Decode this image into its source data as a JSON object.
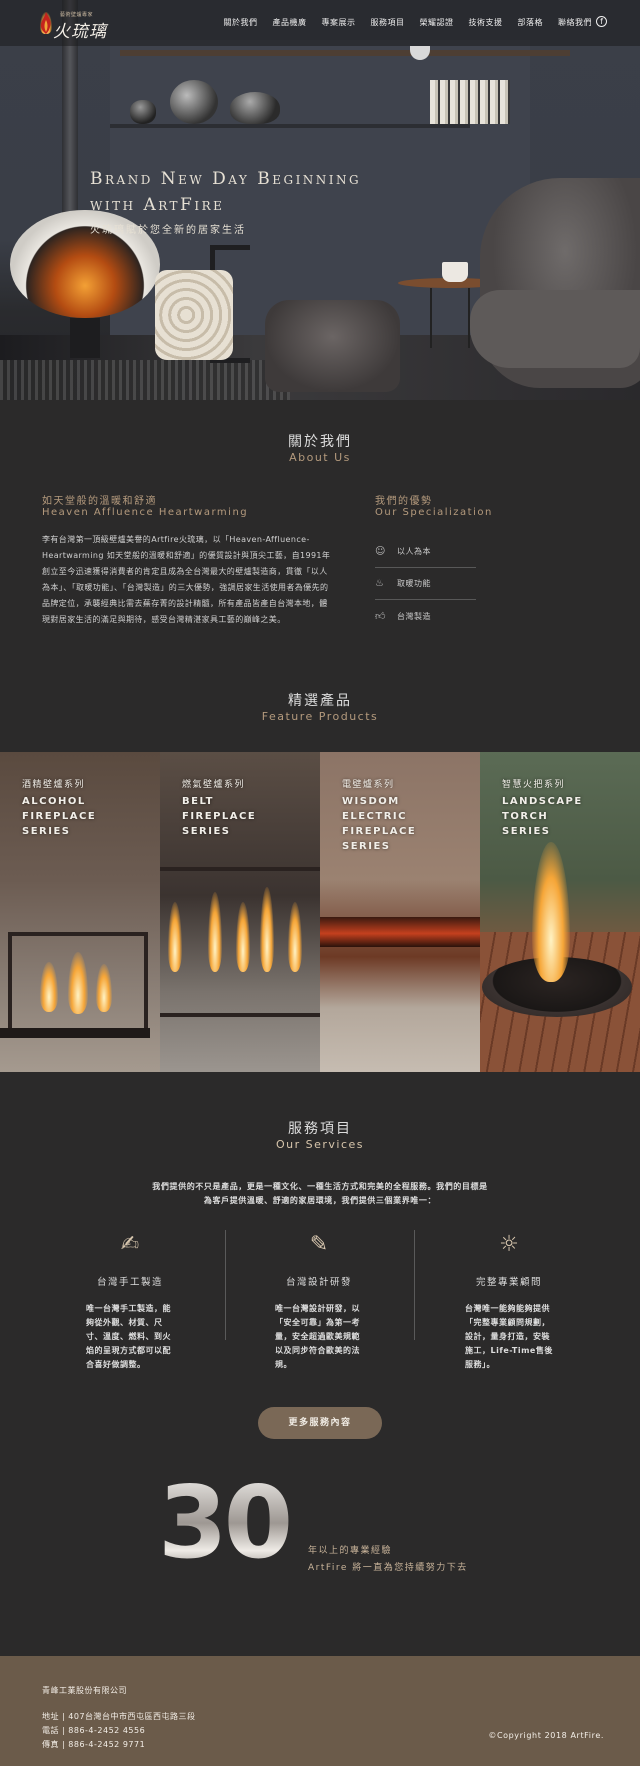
{
  "header": {
    "logo_tagline": "藝術壁爐專家",
    "logo_name": "火琉璃",
    "nav": [
      "關於我們",
      "產品機廣",
      "專案展示",
      "服務項目",
      "榮耀認證",
      "技術支援",
      "部落格",
      "聯絡我們"
    ],
    "facebook_glyph": "f"
  },
  "hero": {
    "title_line1": "Brand New Day Beginning",
    "title_line2": "with ArtFire",
    "subtitle": "火琉璃賦於您全新的居家生活"
  },
  "about": {
    "title": "關於我們",
    "subtitle": "About Us",
    "heading_zh": "如天堂般的溫暖和舒適",
    "heading_en": "Heaven Affluence Heartwarming",
    "body": "李有台灣第一頂級壁爐美譽的Artfire火琉璃，以「Heaven-Affluence-Heartwarming 如天堂般的溫暖和舒適」的優質設計與頂尖工藝，自1991年創立至今迅速獲得消費者的肯定且成為全台灣最大的壁爐製造商，貫徹「以人為本」、「取暖功能」、「台灣製造」的三大優勢，強調居家生活使用者為優先的品牌定位，承襲經典比需去蕪存菁的設計精髓，所有產品皆產自台灣本地，體現對居家生活的滿足與期待，感受台灣精湛家具工藝的巔峰之美。",
    "spec_heading_zh": "我們的優勢",
    "spec_heading_en": "Our Specialization",
    "specs": [
      {
        "icon": "user-icon",
        "label": "以人為本"
      },
      {
        "icon": "flame-icon",
        "label": "取暖功能"
      },
      {
        "icon": "thumbs-up-icon",
        "label": "台灣製造"
      }
    ]
  },
  "products": {
    "title": "精選產品",
    "subtitle": "Feature Products",
    "items": [
      {
        "zh": "酒精壁爐系列",
        "en": [
          "ALCOHOL",
          "FIREPLACE",
          "SERIES"
        ]
      },
      {
        "zh": "燃氣壁爐系列",
        "en": [
          "BELT",
          "FIREPLACE",
          "SERIES"
        ]
      },
      {
        "zh": "電壁爐系列",
        "en": [
          "WISDOM",
          "ELECTRIC",
          "FIREPLACE",
          "SERIES"
        ]
      },
      {
        "zh": "智慧火把系列",
        "en": [
          "LANDSCAPE",
          "TORCH",
          "SERIES"
        ]
      }
    ]
  },
  "services": {
    "title": "服務項目",
    "subtitle": "Our Services",
    "intro": "我們提供的不只是產品，更是一種文化、一種生活方式和完美的全程服務。我們的目標是為客戶提供溫暖、舒適的家居環境，我們提供三個業界唯一：",
    "items": [
      {
        "icon": "hand-crafted-icon",
        "glyph": "✍",
        "title": "台灣手工製造",
        "text": "唯一台灣手工製造，能夠從外觀、材質、尺寸、溫度、燃料、到火焰的呈現方式都可以配合喜好做調整。"
      },
      {
        "icon": "design-icon",
        "glyph": "✎",
        "title": "台灣設計研發",
        "text": "唯一台灣設計研發，以「安全可靠」為第一考量，安全超過歐美規範以及同步符合歐美的法規。"
      },
      {
        "icon": "lightbulb-icon",
        "glyph": "☼",
        "title": "完整專業顧問",
        "text": "台灣唯一能夠能夠提供「完整專業顧問規劃，設計，量身打造，安裝施工，Life-Time售後服務」。"
      }
    ],
    "more_button": "更多服務內容"
  },
  "experience": {
    "number": "30",
    "line1": "年以上的專業經驗",
    "line2": "ArtFire 將一直為您持續努力下去"
  },
  "footer": {
    "company": "青峰工業股份有限公司",
    "address": "地址 | 407台灣台中市西屯區西屯路三段",
    "phone": "電話 | 886-4-2452 4556",
    "fax": "傳真 | 886-4-2452 9771",
    "copyright": "©Copyright 2018 ArtFire."
  },
  "colors": {
    "background": "#2b2a2a",
    "accent_text": "#b49a7d",
    "button": "#7a6856",
    "footer": "#6b5b4a"
  }
}
